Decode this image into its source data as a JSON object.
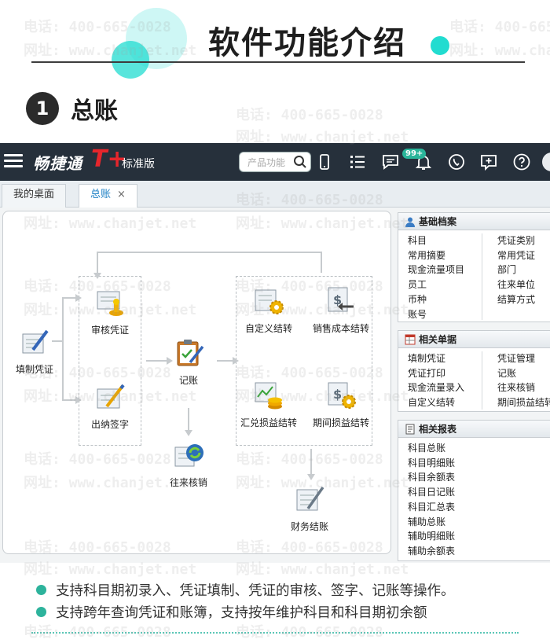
{
  "header": {
    "title": "软件功能介绍",
    "section_number": "1",
    "section_title": "总账"
  },
  "watermark": {
    "phone": "电话: 400-665-0028",
    "site": "网址: www.chanjet.net"
  },
  "appbar": {
    "brand": "畅捷通",
    "brand_mark": "T+",
    "edition": "标准版",
    "search_placeholder": "产品功能",
    "badge": "99+"
  },
  "tabs": [
    {
      "label": "我的桌面"
    },
    {
      "label": "总账"
    }
  ],
  "flow": {
    "nodes": {
      "enter_voucher": "填制凭证",
      "audit_voucher": "审核凭证",
      "cashier_sign": "出纳签字",
      "bookkeeping": "记账",
      "reconcile": "往来核销",
      "custom_transfer": "自定义结转",
      "sales_cost_transfer": "销售成本结转",
      "fx_gain_transfer": "汇兑损益结转",
      "period_gain_transfer": "期间损益结转",
      "financial_close": "财务结账"
    }
  },
  "panels": {
    "basic_archives": {
      "title": "基础档案",
      "left": [
        "科目",
        "常用摘要",
        "现金流量项目",
        "员工",
        "币种",
        "账号"
      ],
      "right": [
        "凭证类别",
        "常用凭证",
        "部门",
        "往来单位",
        "结算方式"
      ]
    },
    "related_docs": {
      "title": "相关单据",
      "left": [
        "填制凭证",
        "凭证打印",
        "现金流量录入",
        "自定义结转"
      ],
      "right": [
        "凭证管理",
        "记账",
        "往来核销",
        "期间损益结转"
      ]
    },
    "related_reports": {
      "title": "相关报表",
      "items": [
        "科目总账",
        "科目明细账",
        "科目余额表",
        "科目日记账",
        "科目汇总表",
        "辅助总账",
        "辅助明细账",
        "辅助余额表"
      ]
    }
  },
  "bullets": [
    "支持科目期初录入、凭证填制、凭证的审核、签字、记账等操作。",
    "支持跨年查询凭证和账簿，支持按年维护科目和科目期初余额"
  ],
  "colors": {
    "accent_cyan": "#22dcd0",
    "appbar_bg": "#26303b",
    "brand_red": "#e5262c",
    "bullet_teal": "#2db39c",
    "tab_active_text": "#1b7fc4"
  }
}
